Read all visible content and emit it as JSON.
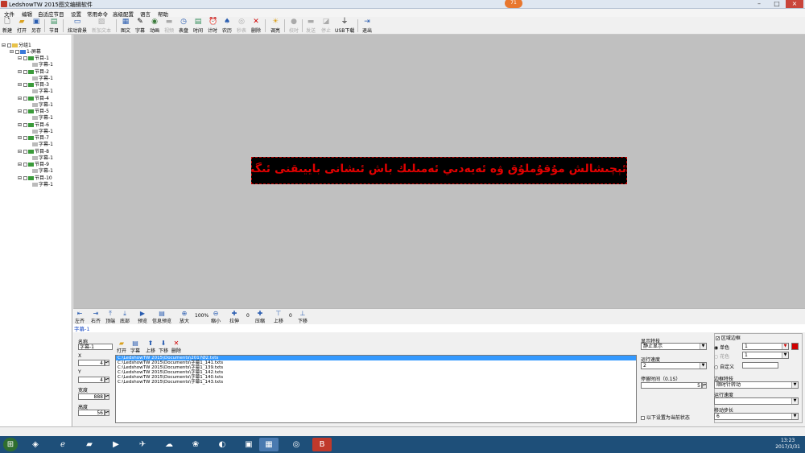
{
  "window": {
    "title": "LedshowTW 2015图文编辑软件",
    "badge": "71"
  },
  "menu": [
    "文件",
    "编辑",
    "自适应节目",
    "设置",
    "常用命令",
    "高级配置",
    "语言",
    "帮助"
  ],
  "toolbar": [
    "新建",
    "打开",
    "另存",
    "节目",
    "炫动背景",
    "新加文本",
    "图文",
    "字幕",
    "动画",
    "视频",
    "表盘",
    "时间",
    "计时",
    "农历",
    "秒表",
    "删除",
    "调亮",
    "校时",
    "发送",
    "停止",
    "USB下载",
    "退出"
  ],
  "toolbar_disabled": [
    "新加文本",
    "视频",
    "秒表",
    "校时",
    "发送",
    "停止"
  ],
  "tree": {
    "root": "分组1",
    "screen": "1-屏幕",
    "programs": [
      "节目-1",
      "节目-2",
      "节目-3",
      "节目-4",
      "节目-5",
      "节目-6",
      "节目-7",
      "节目-8",
      "节目-9",
      "节目-10"
    ],
    "subtitle": "字幕-1"
  },
  "canvas_text": "ئېچىشالش مۇقۇملۇق ۋە ئەيەدىي ئەمىلىك باش ئىشانى باييىقنى ئىگىز كۈتۈرەيلى!",
  "ctrl": [
    "左齐",
    "右齐",
    "顶端",
    "底部",
    "预览",
    "信息预览",
    "放大",
    "100%",
    "缩小",
    "拉伸",
    "0",
    "压缩",
    "上移",
    "0",
    "下移"
  ],
  "panel_title": "字幕-1",
  "props": {
    "name_label": "名称",
    "name_value": "字幕-1",
    "x_label": "X",
    "x_value": "4",
    "y_label": "Y",
    "y_value": "4",
    "w_label": "宽度",
    "w_value": "888",
    "h_label": "高度",
    "h_value": "56"
  },
  "file_actions": [
    "打开",
    "字幕",
    "上移",
    "下移",
    "删除"
  ],
  "files": [
    "C:\\LedshowTW 2015\\Documents\\2017Ø2.txts",
    "C:\\LedshowTW 2015\\Documents\\字幕1_141.txts",
    "C:\\LedshowTW 2015\\Documents\\字幕1_139.txts",
    "C:\\LedshowTW 2015\\Documents\\字幕1_142.txts",
    "C:\\LedshowTW 2015\\Documents\\字幕1_140.txts",
    "C:\\LedshowTW 2015\\Documents\\字幕1_143.txts"
  ],
  "display": {
    "effect_label": "显示特技",
    "effect_value": "静止显示",
    "speed_label": "运行速度",
    "speed_value": "2",
    "stay_label": "停留时间（0.1S）",
    "stay_value": "5",
    "batch_label": "以下设置为当前状态"
  },
  "border": {
    "title": "区域边框",
    "single": "单色",
    "flower": "花色",
    "custom": "自定义",
    "single_value": "1",
    "flower_value": "1",
    "effect_label": "边框特技",
    "effect_value": "顺时针转动",
    "speed_label": "运行速度",
    "speed_value": "",
    "move_label": "移动步长",
    "move_value": "6"
  },
  "clock": {
    "time": "13:23",
    "date": "2017/3/31"
  },
  "colors": {
    "led_text": "#e00000",
    "border_red": "#d00000",
    "accent": "#1f4fc6"
  }
}
